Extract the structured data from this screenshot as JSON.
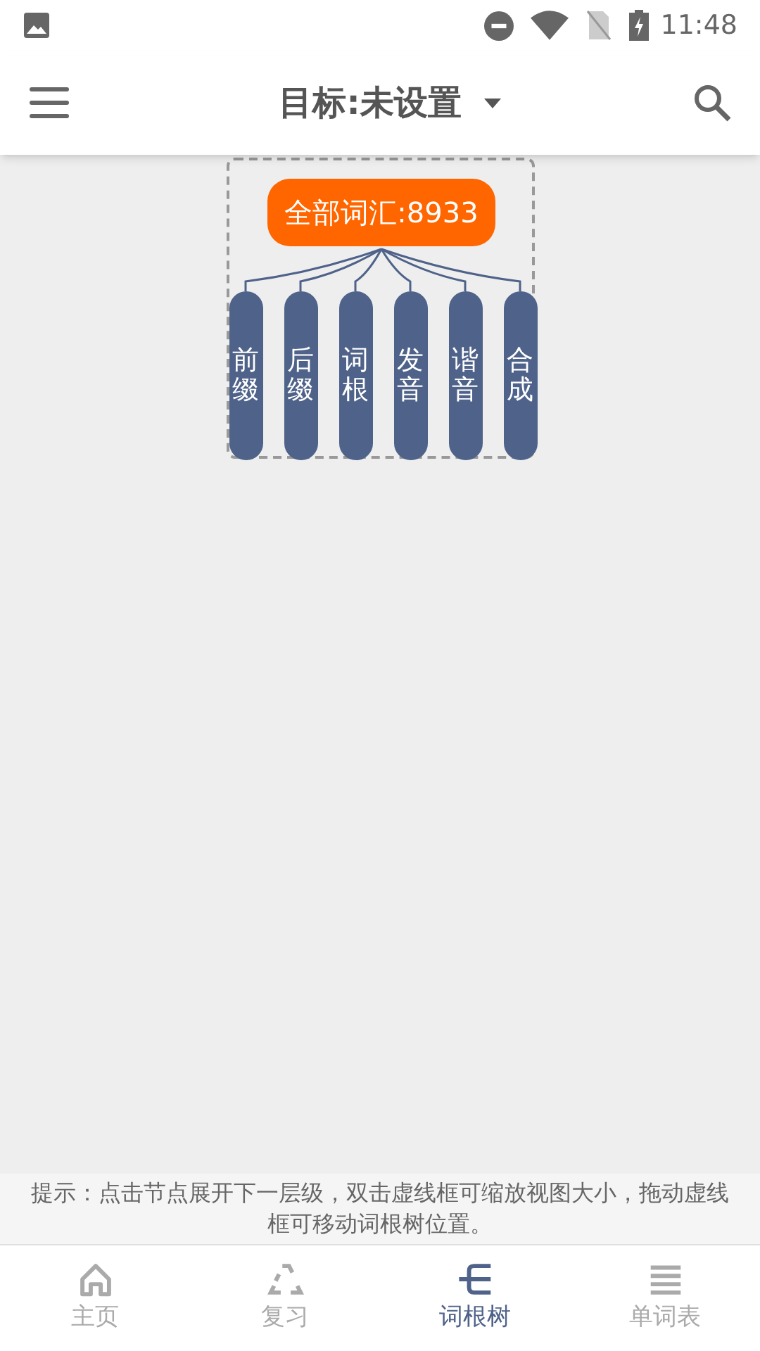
{
  "status_bar": {
    "time": "11:48"
  },
  "app_bar": {
    "title": "目标:未设置"
  },
  "tree": {
    "root": "全部词汇:8933",
    "children": [
      {
        "label": "前缀"
      },
      {
        "label": "后缀"
      },
      {
        "label": "词根"
      },
      {
        "label": "发音"
      },
      {
        "label": "谐音"
      },
      {
        "label": "合成"
      }
    ]
  },
  "hint": "提示：点击节点展开下一层级，双击虚线框可缩放视图大小，拖动虚线框可移动词根树位置。",
  "bottom_nav": [
    {
      "label": "主页",
      "kind": "home",
      "selected": false
    },
    {
      "label": "复习",
      "kind": "recycle",
      "selected": false
    },
    {
      "label": "词根树",
      "kind": "tree",
      "selected": true
    },
    {
      "label": "单词表",
      "kind": "list",
      "selected": false
    }
  ]
}
